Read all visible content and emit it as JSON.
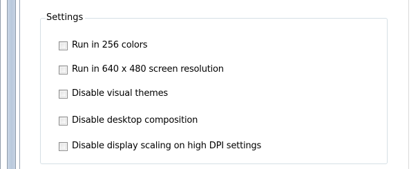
{
  "settings": {
    "title": "Settings",
    "options": [
      {
        "label": "Run in 256 colors",
        "checked": false
      },
      {
        "label": "Run in 640 x 480 screen resolution",
        "checked": false
      },
      {
        "label": "Disable visual themes",
        "checked": false
      },
      {
        "label": "Disable desktop composition",
        "checked": false
      },
      {
        "label": "Disable display scaling on high DPI settings",
        "checked": false
      }
    ]
  }
}
